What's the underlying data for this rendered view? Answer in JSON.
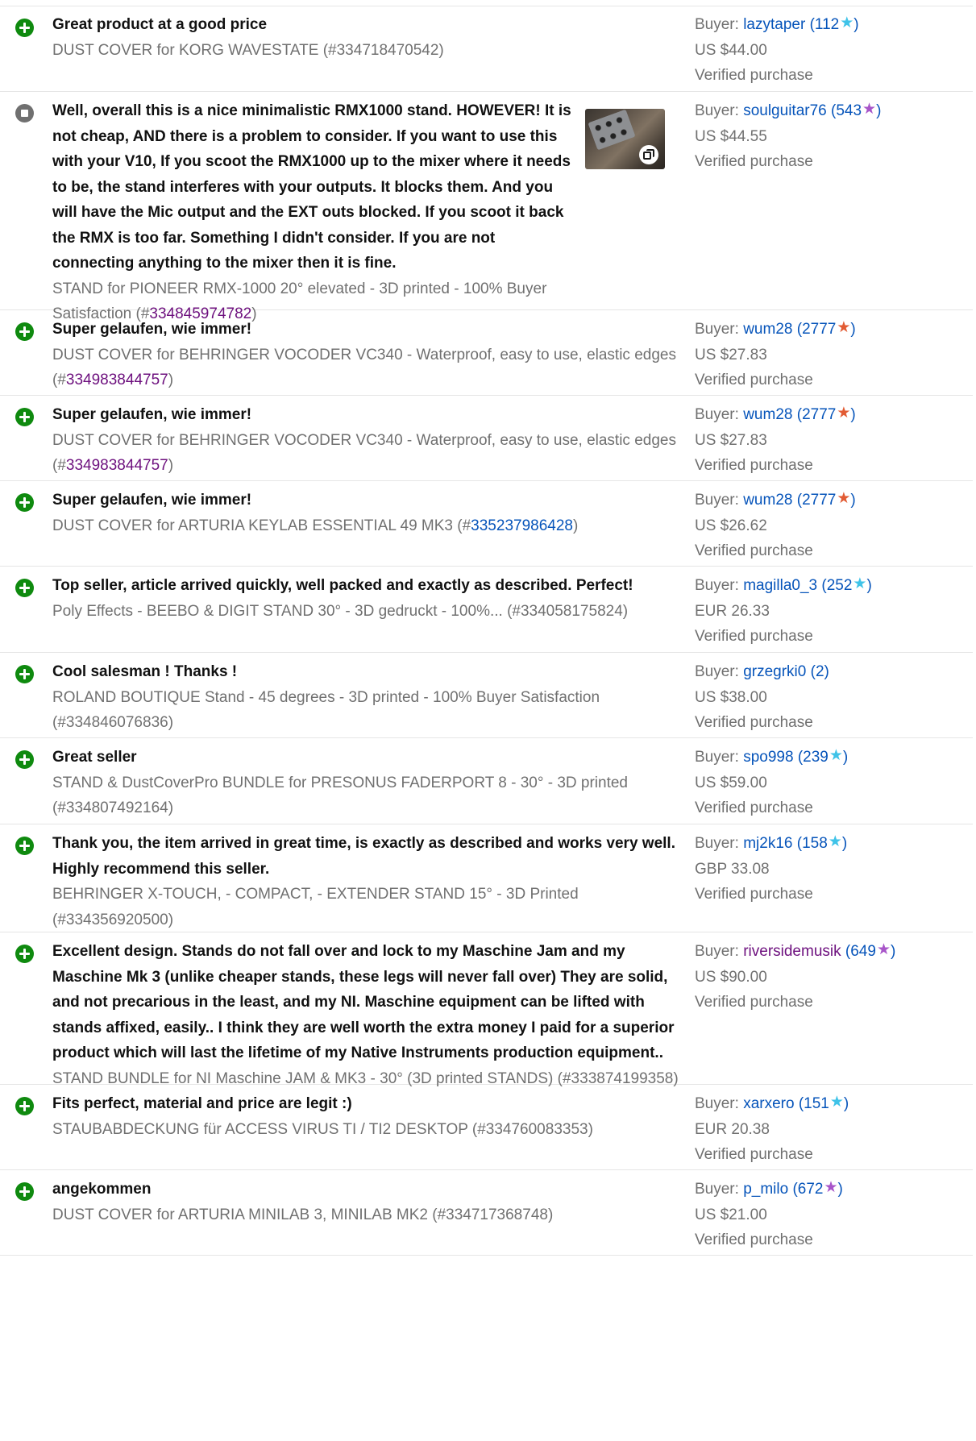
{
  "feedback": [
    {
      "comment": "Great product at a good price",
      "item_text": "DUST COVER for KORG WAVESTATE (",
      "item_number": "#334718470542",
      "item_suffix": ")",
      "buyer_label": "Buyer:",
      "buyer": "lazytaper",
      "score": "112",
      "price": "US $44.00",
      "verified": "Verified purchase"
    },
    {
      "comment": "Well, overall this is a nice minimalistic RMX1000 stand. HOWEVER! It is not cheap, AND there is a problem to consider. If you want to use this with your V10, If you scoot the RMX1000 up to the mixer where it needs to be, the stand interferes with your outputs. It blocks them. And you will have the Mic output and the EXT outs blocked. If you scoot it back the RMX is too far. Something I didn't consider. If you are not connecting anything to the mixer then it is fine.",
      "item_text": "STAND for PIONEER RMX-1000 20° elevated - 3D printed - 100% Buyer Satisfaction (#",
      "item_number": "334845974782",
      "item_suffix": ")",
      "buyer_label": "Buyer:",
      "buyer": "soulguitar76",
      "score": "543",
      "price": "US $44.55",
      "verified": "Verified purchase"
    },
    {
      "comment": "Super gelaufen, wie immer!",
      "item_text": "DUST COVER for BEHRINGER VOCODER VC340 - Waterproof, easy to use, elastic edges (#",
      "item_number": "334983844757",
      "item_suffix": ")",
      "buyer_label": "Buyer:",
      "buyer": "wum28",
      "score": "2777",
      "price": "US $27.83",
      "verified": "Verified purchase"
    },
    {
      "comment": "Super gelaufen, wie immer!",
      "item_text": "DUST COVER for BEHRINGER VOCODER VC340 - Waterproof, easy to use, elastic edges (#",
      "item_number": "334983844757",
      "item_suffix": ")",
      "buyer_label": "Buyer:",
      "buyer": "wum28",
      "score": "2777",
      "price": "US $27.83",
      "verified": "Verified purchase"
    },
    {
      "comment": "Super gelaufen, wie immer!",
      "item_text": "DUST COVER for ARTURIA KEYLAB ESSENTIAL 49 MK3 (#",
      "item_number": "335237986428",
      "item_suffix": ")",
      "buyer_label": "Buyer:",
      "buyer": "wum28",
      "score": "2777",
      "price": "US $26.62",
      "verified": "Verified purchase"
    },
    {
      "comment": "Top seller, article arrived quickly, well packed and exactly as described. Perfect!",
      "item_text": "Poly Effects - BEEBO & DIGIT STAND 30° - 3D gedruckt - 100%... (#334058175824)",
      "buyer_label": "Buyer:",
      "buyer": "magilla0_3",
      "score": "252",
      "price": "EUR 26.33",
      "verified": "Verified purchase"
    },
    {
      "comment": "Cool salesman ! Thanks !",
      "item_text": "ROLAND BOUTIQUE Stand - 45 degrees - 3D printed - 100% Buyer Satisfaction (#334846076836)",
      "buyer_label": "Buyer:",
      "buyer": "grzegrki0",
      "score": "2",
      "price": "US $38.00",
      "verified": "Verified purchase"
    },
    {
      "comment": "Great seller",
      "item_text": "STAND & DustCoverPro BUNDLE for PRESONUS FADERPORT 8 - 30° - 3D printed (#334807492164)",
      "buyer_label": "Buyer:",
      "buyer": "spo998",
      "score": "239",
      "price": "US $59.00",
      "verified": "Verified purchase"
    },
    {
      "comment": "Thank you, the item arrived in great time, is exactly as described and works very well. Highly recommend this seller.",
      "item_text": "BEHRINGER X-TOUCH, - COMPACT, - EXTENDER STAND 15° - 3D Printed (#334356920500)",
      "buyer_label": "Buyer:",
      "buyer": "mj2k16",
      "score": "158",
      "price": "GBP 33.08",
      "verified": "Verified purchase"
    },
    {
      "comment": "Excellent design. Stands do not fall over and lock to my Maschine Jam and my Maschine Mk 3 (unlike cheaper stands, these legs will never fall over) They are solid, and not precarious in the least, and my NI. Maschine equipment can be lifted with stands affixed, easily.. I think they are well worth the extra money I paid for a superior product which will last the lifetime of my Native Instruments production equipment..",
      "item_text": "STAND BUNDLE for NI Maschine JAM & MK3 - 30° (3D printed STANDS) (#333874199358)",
      "buyer_label": "Buyer:",
      "buyer": "riversidemusik",
      "score": "649",
      "price": "US $90.00",
      "verified": "Verified purchase"
    },
    {
      "comment": "Fits perfect, material and price are legit :)",
      "item_text": "STAUBABDECKUNG für ACCESS VIRUS TI / TI2 DESKTOP (#334760083353)",
      "buyer_label": "Buyer:",
      "buyer": "xarxero",
      "score": "151",
      "price": "EUR 20.38",
      "verified": "Verified purchase"
    },
    {
      "comment": "angekommen",
      "item_text": "DUST COVER for ARTURIA MINILAB 3, MINILAB MK2 (#334717368748)",
      "buyer_label": "Buyer:",
      "buyer": "p_milo",
      "score": "672",
      "price": "US $21.00",
      "verified": "Verified purchase"
    }
  ],
  "colors": {
    "positive": "#0f8a0f",
    "neutral": "#707070",
    "link_blue": "#0654ba",
    "link_purple": "#6d107e",
    "star_turquoise": "#3fc3e8",
    "star_purple": "#a855c9",
    "star_red": "#e25b33"
  },
  "icons": {
    "positive": "plus-circle-icon",
    "neutral": "minus-square-circle-icon",
    "star": "star-icon",
    "gallery": "gallery-icon"
  }
}
